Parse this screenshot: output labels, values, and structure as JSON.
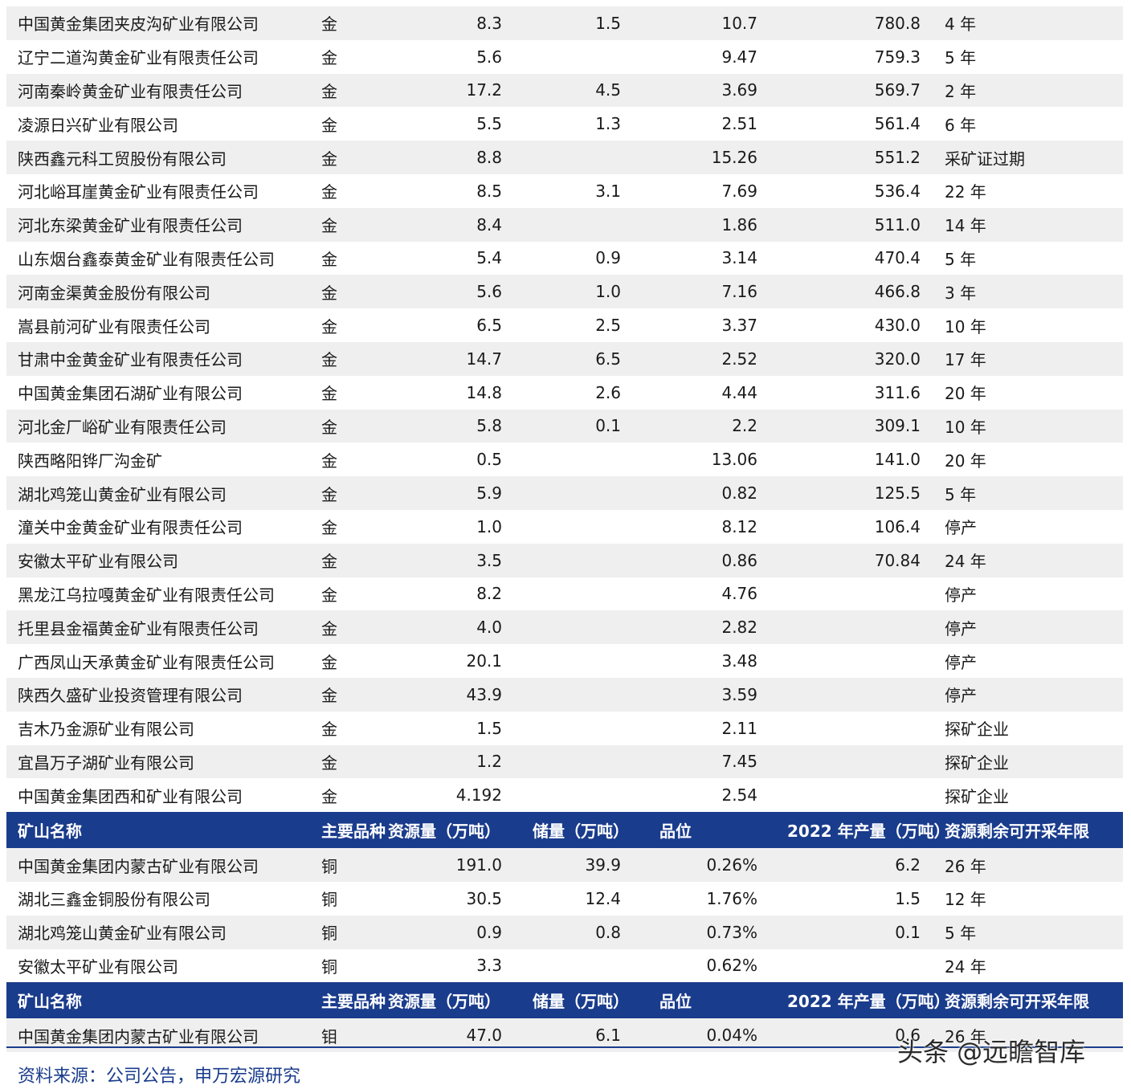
{
  "headers": {
    "name": "矿山名称",
    "kind": "主要品种",
    "resource": "资源量（万吨）",
    "reserve": "储量（万吨）",
    "grade": "品位",
    "production": "2022 年产量（万吨）",
    "life": "资源剩余可开采年限"
  },
  "gold_rows": [
    {
      "name": "中国黄金集团夹皮沟矿业有限公司",
      "kind": "金",
      "resource": "8.3",
      "reserve": "1.5",
      "grade": "10.7",
      "production": "780.8",
      "life": "4 年"
    },
    {
      "name": "辽宁二道沟黄金矿业有限责任公司",
      "kind": "金",
      "resource": "5.6",
      "reserve": "",
      "grade": "9.47",
      "production": "759.3",
      "life": "5 年"
    },
    {
      "name": "河南秦岭黄金矿业有限责任公司",
      "kind": "金",
      "resource": "17.2",
      "reserve": "4.5",
      "grade": "3.69",
      "production": "569.7",
      "life": "2 年"
    },
    {
      "name": "凌源日兴矿业有限公司",
      "kind": "金",
      "resource": "5.5",
      "reserve": "1.3",
      "grade": "2.51",
      "production": "561.4",
      "life": "6 年"
    },
    {
      "name": "陕西鑫元科工贸股份有限公司",
      "kind": "金",
      "resource": "8.8",
      "reserve": "",
      "grade": "15.26",
      "production": "551.2",
      "life": "采矿证过期"
    },
    {
      "name": "河北峪耳崖黄金矿业有限责任公司",
      "kind": "金",
      "resource": "8.5",
      "reserve": "3.1",
      "grade": "7.69",
      "production": "536.4",
      "life": "22 年"
    },
    {
      "name": "河北东梁黄金矿业有限责任公司",
      "kind": "金",
      "resource": "8.4",
      "reserve": "",
      "grade": "1.86",
      "production": "511.0",
      "life": "14 年"
    },
    {
      "name": "山东烟台鑫泰黄金矿业有限责任公司",
      "kind": "金",
      "resource": "5.4",
      "reserve": "0.9",
      "grade": "3.14",
      "production": "470.4",
      "life": "5 年"
    },
    {
      "name": "河南金渠黄金股份有限公司",
      "kind": "金",
      "resource": "5.6",
      "reserve": "1.0",
      "grade": "7.16",
      "production": "466.8",
      "life": "3 年"
    },
    {
      "name": "嵩县前河矿业有限责任公司",
      "kind": "金",
      "resource": "6.5",
      "reserve": "2.5",
      "grade": "3.37",
      "production": "430.0",
      "life": "10 年"
    },
    {
      "name": "甘肃中金黄金矿业有限责任公司",
      "kind": "金",
      "resource": "14.7",
      "reserve": "6.5",
      "grade": "2.52",
      "production": "320.0",
      "life": "17 年"
    },
    {
      "name": "中国黄金集团石湖矿业有限公司",
      "kind": "金",
      "resource": "14.8",
      "reserve": "2.6",
      "grade": "4.44",
      "production": "311.6",
      "life": "20 年"
    },
    {
      "name": "河北金厂峪矿业有限责任公司",
      "kind": "金",
      "resource": "5.8",
      "reserve": "0.1",
      "grade": "2.2",
      "production": "309.1",
      "life": "10 年"
    },
    {
      "name": "陕西略阳铧厂沟金矿",
      "kind": "金",
      "resource": "0.5",
      "reserve": "",
      "grade": "13.06",
      "production": "141.0",
      "life": "20 年"
    },
    {
      "name": "湖北鸡笼山黄金矿业有限公司",
      "kind": "金",
      "resource": "5.9",
      "reserve": "",
      "grade": "0.82",
      "production": "125.5",
      "life": "5 年"
    },
    {
      "name": "潼关中金黄金矿业有限责任公司",
      "kind": "金",
      "resource": "1.0",
      "reserve": "",
      "grade": "8.12",
      "production": "106.4",
      "life": "停产"
    },
    {
      "name": "安徽太平矿业有限公司",
      "kind": "金",
      "resource": "3.5",
      "reserve": "",
      "grade": "0.86",
      "production": "70.84",
      "life": "24 年"
    },
    {
      "name": "黑龙江乌拉嘎黄金矿业有限责任公司",
      "kind": "金",
      "resource": "8.2",
      "reserve": "",
      "grade": "4.76",
      "production": "",
      "life": "停产"
    },
    {
      "name": "托里县金福黄金矿业有限责任公司",
      "kind": "金",
      "resource": "4.0",
      "reserve": "",
      "grade": "2.82",
      "production": "",
      "life": "停产"
    },
    {
      "name": "广西凤山天承黄金矿业有限责任公司",
      "kind": "金",
      "resource": "20.1",
      "reserve": "",
      "grade": "3.48",
      "production": "",
      "life": "停产"
    },
    {
      "name": "陕西久盛矿业投资管理有限公司",
      "kind": "金",
      "resource": "43.9",
      "reserve": "",
      "grade": "3.59",
      "production": "",
      "life": "停产"
    },
    {
      "name": "吉木乃金源矿业有限公司",
      "kind": "金",
      "resource": "1.5",
      "reserve": "",
      "grade": "2.11",
      "production": "",
      "life": "探矿企业"
    },
    {
      "name": "宜昌万子湖矿业有限公司",
      "kind": "金",
      "resource": "1.2",
      "reserve": "",
      "grade": "7.45",
      "production": "",
      "life": "探矿企业"
    },
    {
      "name": "中国黄金集团西和矿业有限公司",
      "kind": "金",
      "resource": "4.192",
      "reserve": "",
      "grade": "2.54",
      "production": "",
      "life": "探矿企业"
    }
  ],
  "copper_rows": [
    {
      "name": "中国黄金集团内蒙古矿业有限公司",
      "kind": "铜",
      "resource": "191.0",
      "reserve": "39.9",
      "grade": "0.26%",
      "production": "6.2",
      "life": "26 年"
    },
    {
      "name": "湖北三鑫金铜股份有限公司",
      "kind": "铜",
      "resource": "30.5",
      "reserve": "12.4",
      "grade": "1.76%",
      "production": "1.5",
      "life": "12 年"
    },
    {
      "name": "湖北鸡笼山黄金矿业有限公司",
      "kind": "铜",
      "resource": "0.9",
      "reserve": "0.8",
      "grade": "0.73%",
      "production": "0.1",
      "life": "5 年"
    },
    {
      "name": "安徽太平矿业有限公司",
      "kind": "铜",
      "resource": "3.3",
      "reserve": "",
      "grade": "0.62%",
      "production": "",
      "life": "24 年"
    }
  ],
  "molybdenum_rows": [
    {
      "name": "中国黄金集团内蒙古矿业有限公司",
      "kind": "钼",
      "resource": "47.0",
      "reserve": "6.1",
      "grade": "0.04%",
      "production": "0.6",
      "life": "26 年"
    }
  ],
  "source_text": "资料来源：公司公告，申万宏源研究",
  "watermark_text": "头条 @远瞻智库",
  "colors": {
    "header_bg": "#1a3c8c",
    "stripe_bg": "#efefef",
    "source_text": "#1a3c8c"
  }
}
